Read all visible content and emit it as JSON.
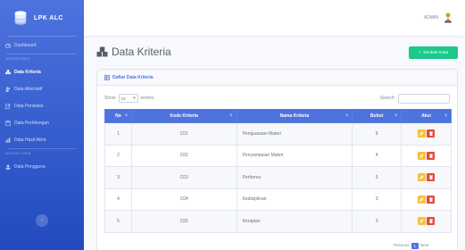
{
  "brand": {
    "name": "LPK ALC"
  },
  "sidebar": {
    "items": [
      {
        "label": "Dashboard"
      },
      {
        "heading": "MASTER DATA"
      },
      {
        "label": "Data Kriteria"
      },
      {
        "label": "Data Alternatif"
      },
      {
        "label": "Data Penilaian"
      },
      {
        "label": "Data Perhitungan"
      },
      {
        "label": "Data Hasil Akhir"
      },
      {
        "heading": "MASTER USER"
      },
      {
        "label": "Data Pengguna"
      }
    ]
  },
  "topbar": {
    "user": "ADMIN"
  },
  "page": {
    "title": "Data Kriteria",
    "add_label": "Tambah Data"
  },
  "card": {
    "title": "Daftar Data Kriteria"
  },
  "controls": {
    "show_label": "Show",
    "entries_value": "10",
    "entries_label": "entries",
    "search_label": "Search:"
  },
  "table": {
    "headers": [
      "No",
      "Kode Kriteria",
      "Nama Kriteria",
      "Bobot",
      "Aksi"
    ],
    "rows": [
      {
        "no": "1",
        "kode": "C01",
        "nama": "Penguasaan Materi",
        "bobot": "5"
      },
      {
        "no": "2",
        "kode": "C02",
        "nama": "Penyampaian Materi",
        "bobot": "4"
      },
      {
        "no": "3",
        "kode": "C03",
        "nama": "Performa",
        "bobot": "5"
      },
      {
        "no": "4",
        "kode": "C04",
        "nama": "Kedisiplinan",
        "bobot": "3"
      },
      {
        "no": "5",
        "kode": "C05",
        "nama": "Kerapian",
        "bobot": "3"
      }
    ]
  },
  "pagination": {
    "prev": "Previous",
    "current": "1",
    "next": "Next"
  },
  "colors": {
    "primary": "#4e73df",
    "success": "#1cc88a",
    "warning": "#f6c23e",
    "danger": "#e74a3b"
  }
}
